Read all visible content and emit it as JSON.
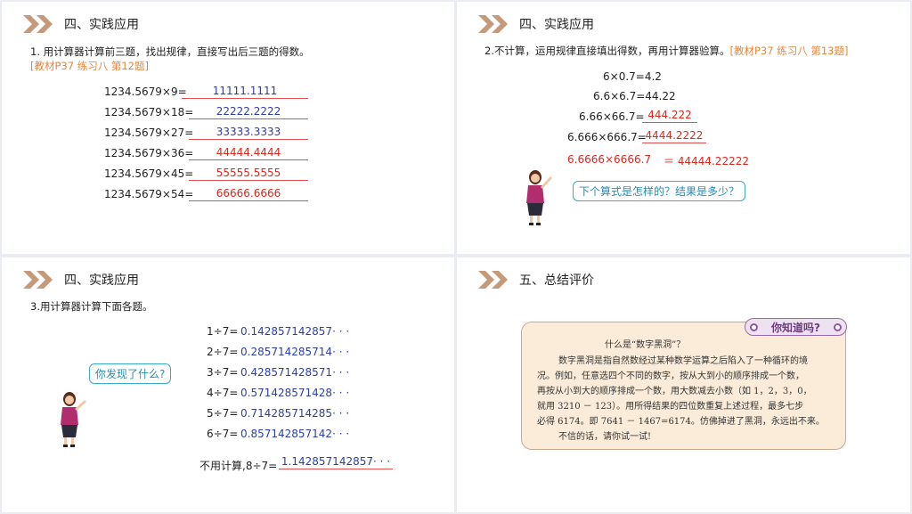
{
  "panel1": {
    "header": "四、实践应用",
    "question": "1. 用计算器计算前三题，找出规律，直接写出后三题的得数。",
    "reference": "[教材P37  练习八 第12题]",
    "rows": [
      {
        "expr": "1234.5679×9=",
        "answer": "11111.1111",
        "color": "blue"
      },
      {
        "expr": "1234.5679×18=",
        "answer": "22222.2222",
        "color": "blue"
      },
      {
        "expr": "1234.5679×27=",
        "answer": "33333.3333",
        "color": "blue"
      },
      {
        "expr": "1234.5679×36=",
        "answer": "44444.4444",
        "color": "red"
      },
      {
        "expr": "1234.5679×45=",
        "answer": "55555.5555",
        "color": "red"
      },
      {
        "expr": "1234.5679×54=",
        "answer": "66666.6666",
        "color": "red"
      }
    ]
  },
  "panel2": {
    "header": "四、实践应用",
    "question": "2.不计算，运用规律直接填出得数，再用计算器验算。",
    "reference": "[教材P37  练习八 第13题]",
    "line1": "6×0.7=4.2",
    "line2": "6.6×6.7=44.22",
    "line3_expr": "6.66×66.7=",
    "line3_answer": "444.222",
    "line4_expr": "6.666×666.7=",
    "line4_answer": "4444.2222",
    "line5_expr": "6.6666×6666.7",
    "line5_answer": "＝ 44444.22222",
    "bubble": "下个算式是怎样的？结果是多少？"
  },
  "panel3": {
    "header": "四、实践应用",
    "question": "3.用计算器计算下面各题。",
    "rows": [
      {
        "expr": "1÷7=",
        "answer": "0.142857142857· · ·"
      },
      {
        "expr": "2÷7=",
        "answer": "0.285714285714· · ·"
      },
      {
        "expr": "3÷7=",
        "answer": "0.428571428571· · ·"
      },
      {
        "expr": "4÷7=",
        "answer": "0.571428571428· · ·"
      },
      {
        "expr": "5÷7=",
        "answer": "0.714285714285· · ·"
      },
      {
        "expr": "6÷7=",
        "answer": "0.857142857142· · ·"
      }
    ],
    "bubble": "你发现了什么?",
    "last_expr": "不用计算,8÷7=",
    "last_answer": "1.142857142857· · ·"
  },
  "panel4": {
    "header": "五、总结评价",
    "badge": "你知道吗?",
    "title": "什么是“数字黑洞”？",
    "para": [
      "数字黑洞是指自然数经过某种数学运算之后陷入了一种循环的境",
      "况。例如，任意选四个不同的数字，按从大到小的顺序排成一个数，",
      "再按从小到大的顺序排成一个数，用大数减去小数（如 1，2，3，0，",
      "就用 3210 － 123）。用所得结果的四位数重复上述过程，最多七步",
      "必得 6174。即 7641 － 1467=6174。仿佛掉进了黑洞，永远出不来。",
      "不信的话，请你试一试!"
    ]
  },
  "colors": {
    "arrow": "#c49a7a",
    "orange": "#e8843a",
    "blue": "#2c3fa8",
    "red": "#e0251b",
    "bubble_border": "#3aa8c8"
  }
}
